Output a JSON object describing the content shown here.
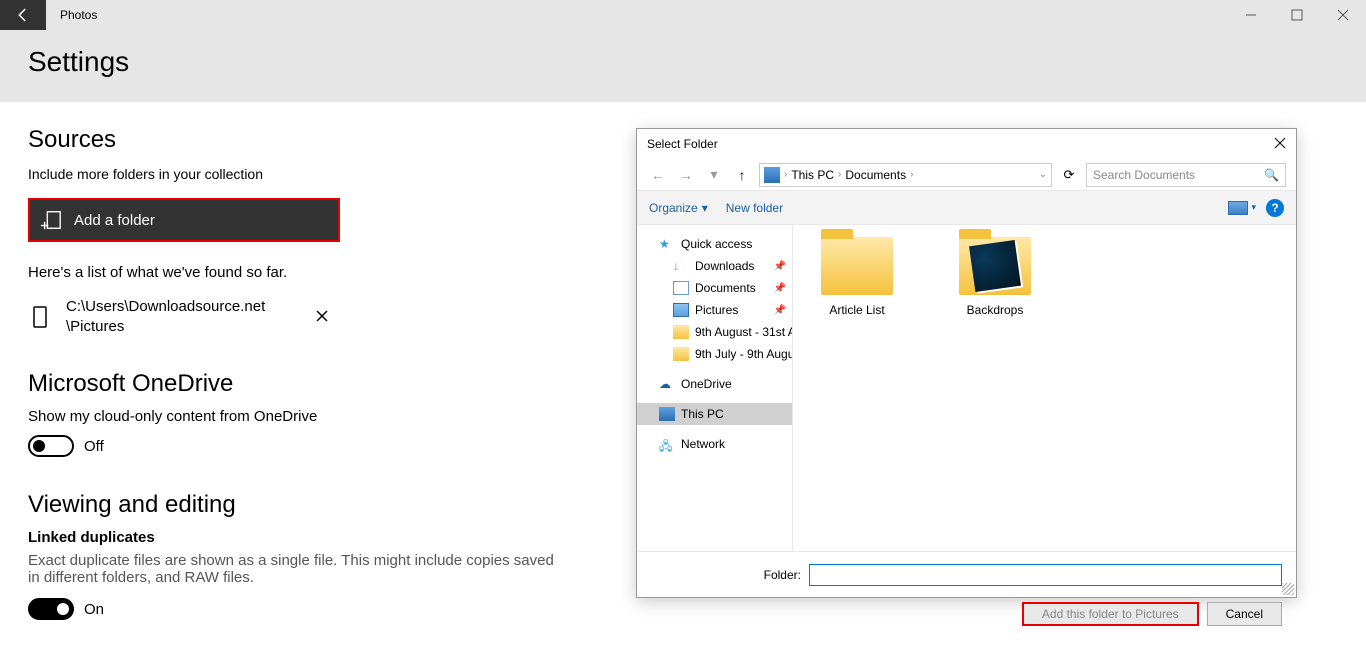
{
  "titlebar": {
    "app_name": "Photos"
  },
  "page": {
    "heading": "Settings"
  },
  "sources": {
    "heading": "Sources",
    "subtitle": "Include more folders in your collection",
    "add_button": "Add a folder",
    "found_text": "Here's a list of what we've found so far.",
    "folder_path_line1": "C:\\Users\\Downloadsource.net",
    "folder_path_line2": "\\Pictures"
  },
  "onedrive": {
    "heading": "Microsoft OneDrive",
    "desc": "Show my cloud-only content from OneDrive",
    "toggle_label": "Off"
  },
  "viewing": {
    "heading": "Viewing and editing",
    "sub": "Linked duplicates",
    "body": "Exact duplicate files are shown as a single file. This might include copies saved in different folders, and RAW files.",
    "toggle_label": "On"
  },
  "dialog": {
    "title": "Select Folder",
    "breadcrumb": [
      "This PC",
      "Documents"
    ],
    "search_placeholder": "Search Documents",
    "organize": "Organize",
    "new_folder": "New folder",
    "tree": {
      "quick_access": "Quick access",
      "downloads": "Downloads",
      "documents": "Documents",
      "pictures": "Pictures",
      "range1": "9th August - 31st Au",
      "range2": "9th July - 9th Augus",
      "onedrive": "OneDrive",
      "this_pc": "This PC",
      "network": "Network"
    },
    "files": {
      "article_list": "Article List",
      "backdrops": "Backdrops"
    },
    "folder_label": "Folder:",
    "add_button": "Add this folder to Pictures",
    "cancel_button": "Cancel"
  }
}
